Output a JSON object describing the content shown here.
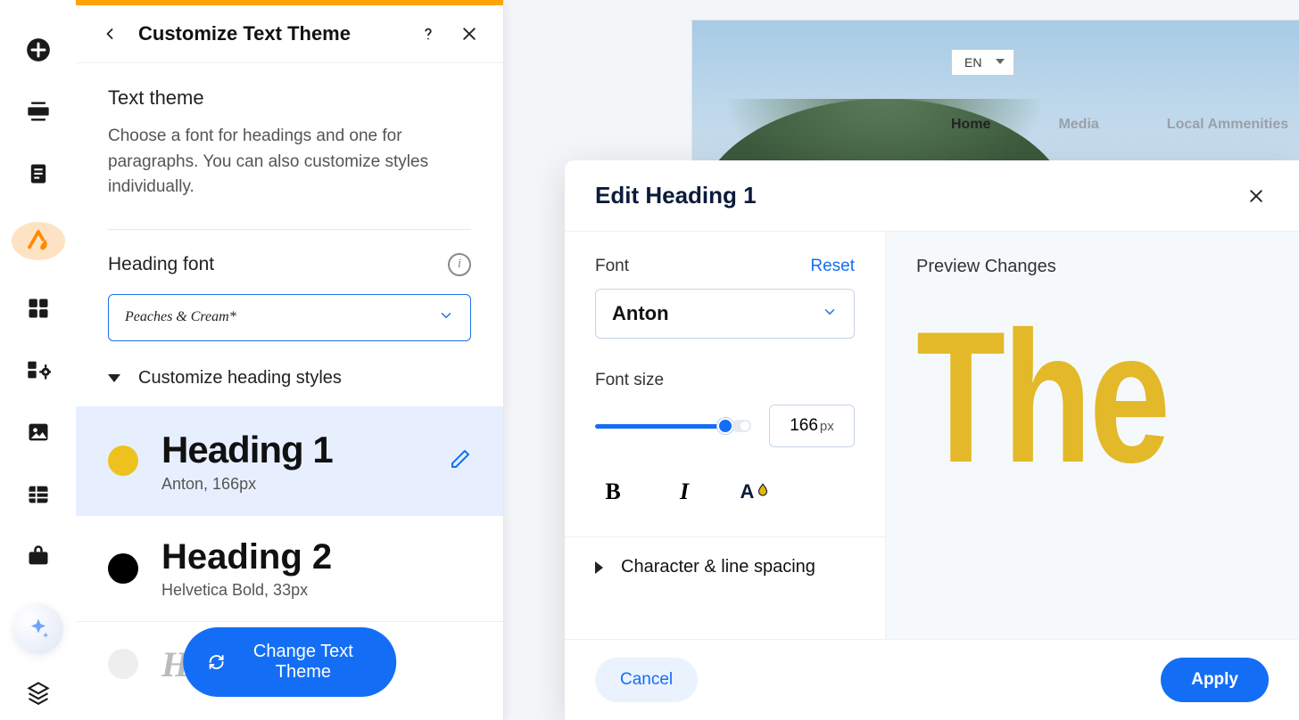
{
  "panel": {
    "title": "Customize Text Theme",
    "section_title": "Text theme",
    "section_desc": "Choose a font for headings and one for paragraphs. You can also customize styles individually.",
    "heading_font_label": "Heading font",
    "heading_font_value": "Peaches & Cream*",
    "customize_toggle": "Customize heading styles",
    "headings": [
      {
        "name": "Heading 1",
        "meta": "Anton, 166px",
        "swatch": "#eec21e",
        "selected": true
      },
      {
        "name": "Heading 2",
        "meta": "Helvetica Bold, 33px",
        "swatch": "#000000",
        "selected": false
      },
      {
        "name": "Heading 3",
        "meta": "",
        "swatch": "#eeeeee",
        "selected": false
      }
    ],
    "change_theme_btn": "Change Text Theme"
  },
  "site": {
    "lang": "EN",
    "nav": [
      "Home",
      "Media",
      "Local Ammenities"
    ],
    "active_nav": 0
  },
  "modal": {
    "title": "Edit Heading 1",
    "font_label": "Font",
    "reset": "Reset",
    "font_value": "Anton",
    "size_label": "Font size",
    "size_value": "166",
    "size_unit": "px",
    "spacing_label": "Character & line spacing",
    "preview_label": "Preview Changes",
    "preview_sample": "The",
    "cancel": "Cancel",
    "apply": "Apply"
  }
}
